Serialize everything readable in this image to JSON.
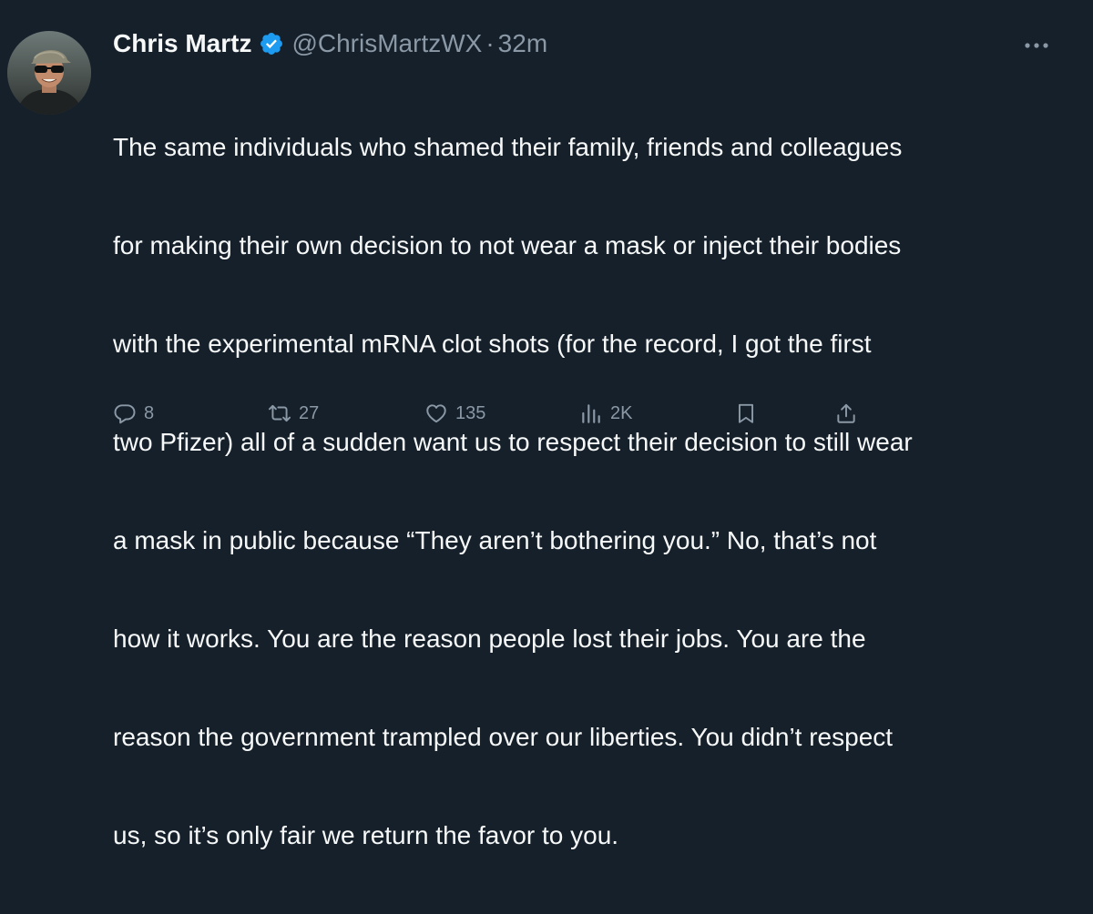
{
  "tweet": {
    "author_name": "Chris Martz",
    "handle": "@ChrisMartzWX",
    "separator": "·",
    "time": "32m",
    "lines": [
      "The same individuals who shamed their family, friends and colleagues",
      "for making their own decision to not wear a mask or inject their bodies",
      "with the experimental mRNA clot shots (for the record, I got the first",
      "two Pfizer) all of a sudden want us to respect their decision to still wear",
      "a mask in public because “They aren’t bothering you.” No, that’s not",
      "how it works. You are the reason people lost their jobs. You are the",
      "reason the government trampled over our liberties. You didn’t respect",
      "us, so it’s only fair we return the favor to you."
    ],
    "actions": {
      "replies": "8",
      "retweets": "27",
      "likes": "135",
      "views": "2K"
    }
  },
  "icons": {
    "verified": "verified-badge-icon",
    "more": "more-dots-icon",
    "reply": "reply-bubble-icon",
    "retweet": "retweet-icon",
    "like": "heart-icon",
    "views": "views-bar-chart-icon",
    "bookmark": "bookmark-icon",
    "share": "share-icon"
  },
  "colors": {
    "background": "#15202b",
    "text": "#f7f9f9",
    "secondary": "#8b98a5",
    "verified": "#1d9bf0"
  }
}
